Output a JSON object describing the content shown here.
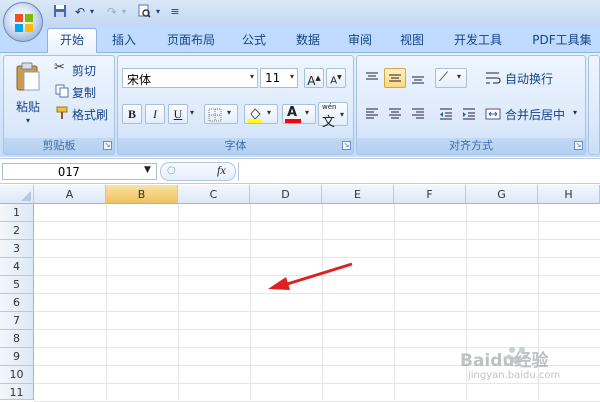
{
  "ribbon_tabs": [
    "开始",
    "插入",
    "页面布局",
    "公式",
    "数据",
    "审阅",
    "视图",
    "开发工具",
    "PDF工具集"
  ],
  "clipboard": {
    "paste": "粘贴",
    "cut": "剪切",
    "copy": "复制",
    "format_painter": "格式刷",
    "group_label": "剪贴板"
  },
  "font": {
    "name": "宋体",
    "size": "11",
    "bold": "B",
    "italic": "I",
    "underline": "U",
    "font_color_glyph": "A",
    "pinyin": "wén",
    "pinyin_char": "文",
    "group_label": "字体"
  },
  "alignment": {
    "wrap_text": "自动换行",
    "merge_center": "合并后居中",
    "group_label": "对齐方式"
  },
  "formula_bar": {
    "name_box": "O17",
    "fx": "fx"
  },
  "columns": [
    "A",
    "B",
    "C",
    "D",
    "E",
    "F",
    "G",
    "H"
  ],
  "rows": [
    "1",
    "2",
    "3",
    "4",
    "5",
    "6",
    "7",
    "8",
    "9",
    "10",
    "11"
  ],
  "colors": {
    "accent": "#15428b",
    "highlight_fill": "#ffff00",
    "font_color": "#ff0000",
    "arrow": "#e02020"
  },
  "watermark": {
    "brand": "Baidu经验",
    "url": "jingyan.baidu.com"
  }
}
